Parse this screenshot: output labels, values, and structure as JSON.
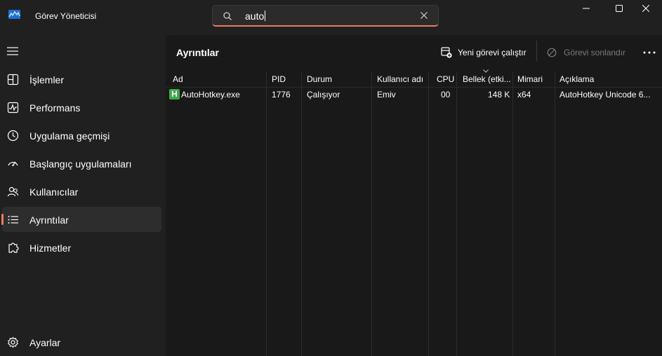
{
  "app": {
    "title": "Görev Yöneticisi"
  },
  "search": {
    "value": "auto"
  },
  "sidebar": {
    "items": [
      {
        "label": "İşlemler",
        "icon": "processes-grid-icon"
      },
      {
        "label": "Performans",
        "icon": "performance-graph-icon"
      },
      {
        "label": "Uygulama geçmişi",
        "icon": "history-clock-icon"
      },
      {
        "label": "Başlangıç uygulamaları",
        "icon": "speedometer-icon"
      },
      {
        "label": "Kullanıcılar",
        "icon": "users-icon"
      },
      {
        "label": "Ayrıntılar",
        "icon": "details-list-icon",
        "active": true
      },
      {
        "label": "Hizmetler",
        "icon": "services-puzzle-icon"
      }
    ],
    "settings": {
      "label": "Ayarlar",
      "icon": "gear-icon"
    }
  },
  "main": {
    "title": "Ayrıntılar",
    "toolbar": {
      "new_task": "Yeni görevi çalıştır",
      "end_task": "Görevi sonlandır"
    }
  },
  "table": {
    "columns": [
      "Ad",
      "PID",
      "Durum",
      "Kullanıcı adı",
      "CPU",
      "Bellek (etki...",
      "Mimari",
      "Açıklama"
    ],
    "rows": [
      {
        "name": "AutoHotkey.exe",
        "pid": "1776",
        "status": "Çalışıyor",
        "user": "Emiv",
        "cpu": "00",
        "memory": "148 K",
        "arch": "x64",
        "description": "AutoHotkey Unicode 6..."
      }
    ],
    "row_icon_letter": "H"
  },
  "colors": {
    "accent": "#f07b5a",
    "background": "#202020",
    "content": "#191919",
    "ahk_green": "#3fa84a"
  }
}
